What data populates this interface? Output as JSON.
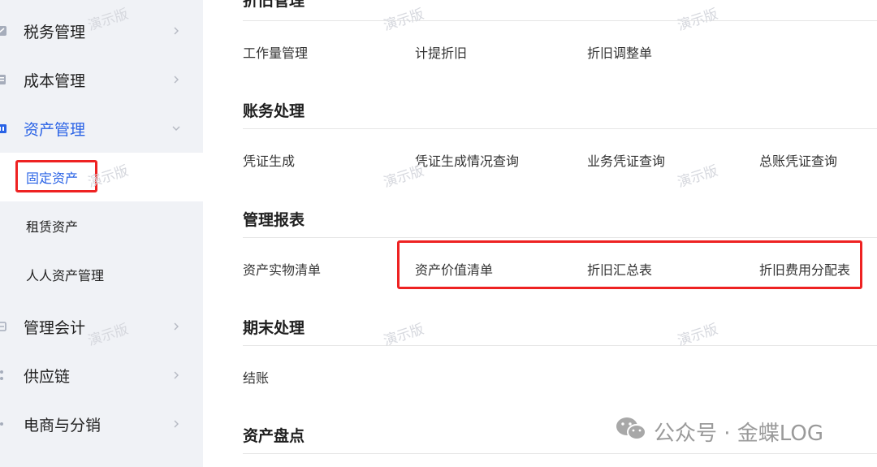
{
  "sidebar": {
    "items": [
      {
        "label": "税务管理",
        "icon": "tax-icon"
      },
      {
        "label": "成本管理",
        "icon": "cost-icon"
      },
      {
        "label": "资产管理",
        "icon": "asset-icon",
        "expanded": true
      },
      {
        "label": "管理会计",
        "icon": "accounting-icon"
      },
      {
        "label": "供应链",
        "icon": "supply-chain-icon"
      },
      {
        "label": "电商与分销",
        "icon": "ecommerce-icon"
      }
    ],
    "subitems": [
      {
        "label": "固定资产",
        "selected": true
      },
      {
        "label": "租赁资产"
      },
      {
        "label": "人人资产管理"
      }
    ]
  },
  "main": {
    "sections": [
      {
        "title": "折旧管理",
        "links": [
          "工作量管理",
          "计提折旧",
          "折旧调整单"
        ]
      },
      {
        "title": "账务处理",
        "links": [
          "凭证生成",
          "凭证生成情况查询",
          "业务凭证查询",
          "总账凭证查询"
        ]
      },
      {
        "title": "管理报表",
        "links": [
          "资产实物清单",
          "资产价值清单",
          "折旧汇总表",
          "折旧费用分配表"
        ]
      },
      {
        "title": "期末处理",
        "links": [
          "结账"
        ]
      },
      {
        "title": "资产盘点",
        "links": []
      }
    ]
  },
  "watermark": "演示版",
  "footer": {
    "brand": "公众号 · 金蝶LOG"
  },
  "colors": {
    "accent": "#2a63e6",
    "highlight": "#ee2222",
    "sidebar_bg": "#f0f2f6"
  }
}
